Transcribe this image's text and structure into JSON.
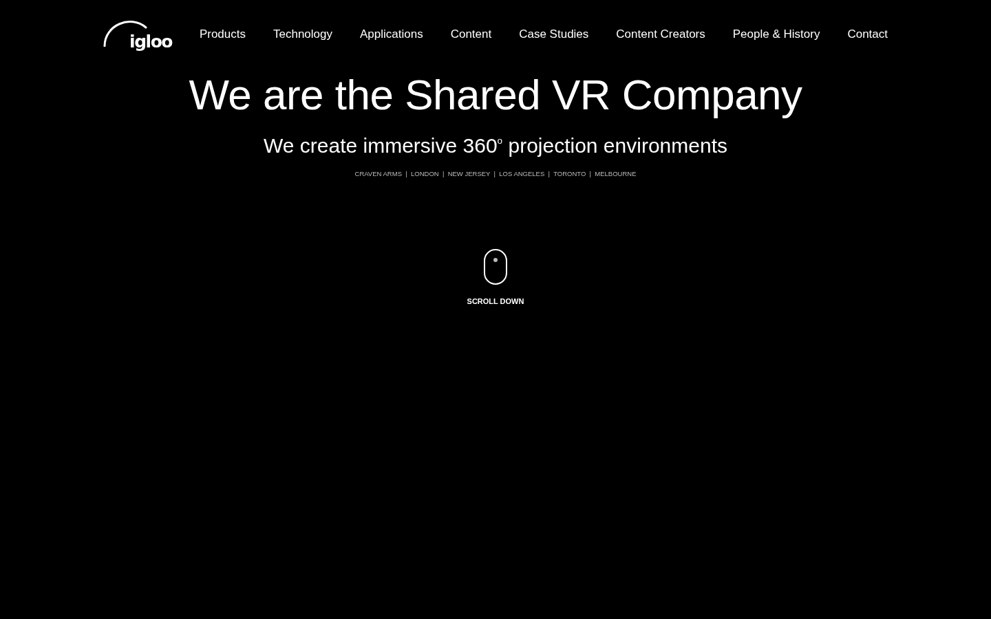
{
  "logo": {
    "text": "igloo"
  },
  "nav": [
    "Products",
    "Technology",
    "Applications",
    "Content",
    "Case Studies",
    "Content Creators",
    "People & History",
    "Contact"
  ],
  "hero": {
    "title": "We are the Shared VR Company",
    "subtitle": "We create immersive 360$^{o}$ projection environments",
    "locations": "CRAVEN ARMS  |  LONDON  |  NEW JERSEY  |  LOS ANGELES  |  TORONTO  |  MELBOURNE"
  },
  "scroll": {
    "label": "SCROLL DOWN"
  }
}
